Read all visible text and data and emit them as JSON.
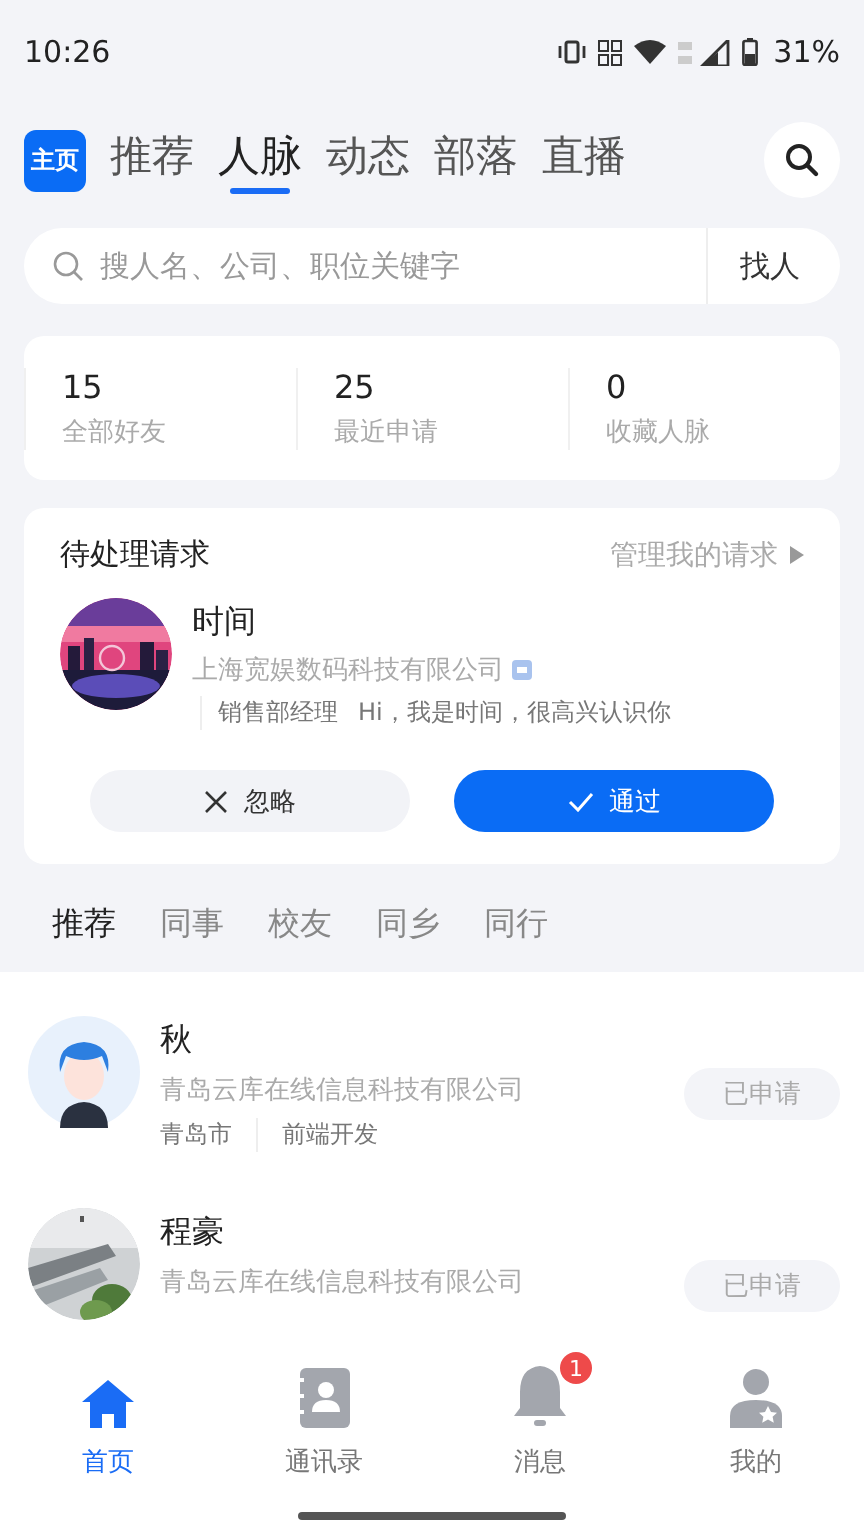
{
  "status_bar": {
    "time": "10:26",
    "battery": "31%"
  },
  "header": {
    "logo": "主页",
    "tabs": [
      {
        "label": "推荐",
        "selected": false
      },
      {
        "label": "人脉",
        "selected": true
      },
      {
        "label": "动态",
        "selected": false
      },
      {
        "label": "部落",
        "selected": false
      },
      {
        "label": "直播",
        "selected": false
      }
    ]
  },
  "search": {
    "placeholder": "搜人名、公司、职位关键字",
    "button": "找人"
  },
  "stats": [
    {
      "value": "15",
      "label": "全部好友"
    },
    {
      "value": "25",
      "label": "最近申请"
    },
    {
      "value": "0",
      "label": "收藏人脉"
    }
  ],
  "pending": {
    "title": "待处理请求",
    "manage": "管理我的请求",
    "name": "时间",
    "company": "上海宽娱数码科技有限公司",
    "position": "销售部经理",
    "message": "Hi，我是时间，很高兴认识你",
    "ignore": "忽略",
    "accept": "通过"
  },
  "filters": [
    {
      "label": "推荐",
      "selected": true
    },
    {
      "label": "同事",
      "selected": false
    },
    {
      "label": "校友",
      "selected": false
    },
    {
      "label": "同乡",
      "selected": false
    },
    {
      "label": "同行",
      "selected": false
    }
  ],
  "people": [
    {
      "name": "秋",
      "company": "青岛云库在线信息科技有限公司",
      "city": "青岛市",
      "job": "前端开发",
      "action": "已申请",
      "avatar": {
        "kind": "avatar"
      }
    },
    {
      "name": "程豪",
      "company": "青岛云库在线信息科技有限公司",
      "action": "已申请"
    }
  ],
  "nav": [
    {
      "label": "首页",
      "kind": "home",
      "selected": true
    },
    {
      "label": "通讯录",
      "kind": "contacts",
      "selected": false
    },
    {
      "label": "消息",
      "kind": "bell",
      "selected": false,
      "badge": "1"
    },
    {
      "label": "我的",
      "kind": "user",
      "selected": false
    }
  ]
}
